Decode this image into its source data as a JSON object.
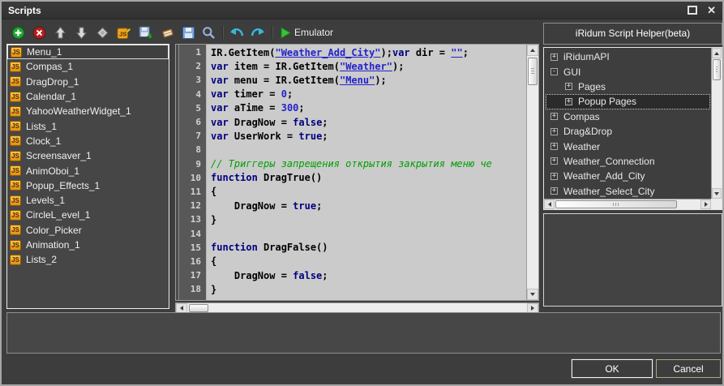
{
  "window": {
    "title": "Scripts",
    "close_glyph": "✕"
  },
  "left_toolbar": {
    "icons": [
      "add",
      "delete",
      "move-up",
      "move-down",
      "diamond",
      "edit-js",
      "save-script",
      "clear"
    ]
  },
  "editor_toolbar": {
    "icons": [
      "save",
      "find",
      "undo",
      "redo",
      "play"
    ],
    "emulator_label": "Emulator"
  },
  "script_list": {
    "badge": "JS",
    "items": [
      {
        "label": "Menu_1",
        "selected": true
      },
      {
        "label": "Compas_1",
        "selected": false
      },
      {
        "label": "DragDrop_1",
        "selected": false
      },
      {
        "label": "Calendar_1",
        "selected": false
      },
      {
        "label": "YahooWeatherWidget_1",
        "selected": false
      },
      {
        "label": "Lists_1",
        "selected": false
      },
      {
        "label": "Clock_1",
        "selected": false
      },
      {
        "label": "Screensaver_1",
        "selected": false
      },
      {
        "label": "AnimOboi_1",
        "selected": false
      },
      {
        "label": "Popup_Effects_1",
        "selected": false
      },
      {
        "label": "Levels_1",
        "selected": false
      },
      {
        "label": "CircleL_evel_1",
        "selected": false
      },
      {
        "label": "Color_Picker",
        "selected": false
      },
      {
        "label": "Animation_1",
        "selected": false
      },
      {
        "label": "Lists_2",
        "selected": false
      }
    ]
  },
  "editor": {
    "lines": [
      {
        "num": 1,
        "tokens": [
          [
            "IR.GetItem(",
            "p"
          ],
          [
            "\"Weather_Add_City\"",
            "s"
          ],
          [
            ");",
            "p"
          ],
          [
            "var",
            "k"
          ],
          [
            " dir = ",
            "p"
          ],
          [
            "\"\"",
            "s"
          ],
          [
            ";",
            "p"
          ]
        ]
      },
      {
        "num": 2,
        "tokens": [
          [
            "var",
            "k"
          ],
          [
            " item = IR.GetItem(",
            "p"
          ],
          [
            "\"Weather\"",
            "s"
          ],
          [
            ");",
            "p"
          ]
        ]
      },
      {
        "num": 3,
        "tokens": [
          [
            "var",
            "k"
          ],
          [
            " menu = IR.GetItem(",
            "p"
          ],
          [
            "\"Menu\"",
            "s"
          ],
          [
            ");",
            "p"
          ]
        ]
      },
      {
        "num": 4,
        "tokens": [
          [
            "var",
            "k"
          ],
          [
            " timer = ",
            "p"
          ],
          [
            "0",
            "n"
          ],
          [
            ";",
            "p"
          ]
        ]
      },
      {
        "num": 5,
        "tokens": [
          [
            "var",
            "k"
          ],
          [
            " aTime = ",
            "p"
          ],
          [
            "300",
            "n"
          ],
          [
            ";",
            "p"
          ]
        ]
      },
      {
        "num": 6,
        "tokens": [
          [
            "var",
            "k"
          ],
          [
            " DragNow = ",
            "p"
          ],
          [
            "false",
            "k"
          ],
          [
            ";",
            "p"
          ]
        ]
      },
      {
        "num": 7,
        "tokens": [
          [
            "var",
            "k"
          ],
          [
            " UserWork = ",
            "p"
          ],
          [
            "true",
            "k"
          ],
          [
            ";",
            "p"
          ]
        ]
      },
      {
        "num": 8,
        "tokens": []
      },
      {
        "num": 9,
        "tokens": [
          [
            "// Триггеры запрещения открытия закрытия меню че",
            "c"
          ]
        ]
      },
      {
        "num": 10,
        "tokens": [
          [
            "function",
            "k"
          ],
          [
            " DragTrue()",
            "p"
          ]
        ]
      },
      {
        "num": 11,
        "tokens": [
          [
            "{",
            "p"
          ]
        ]
      },
      {
        "num": 12,
        "tokens": [
          [
            "    DragNow = ",
            "p"
          ],
          [
            "true",
            "k"
          ],
          [
            ";",
            "p"
          ]
        ]
      },
      {
        "num": 13,
        "tokens": [
          [
            "}",
            "p"
          ]
        ]
      },
      {
        "num": 14,
        "tokens": []
      },
      {
        "num": 15,
        "tokens": [
          [
            "function",
            "k"
          ],
          [
            " DragFalse()",
            "p"
          ]
        ]
      },
      {
        "num": 16,
        "tokens": [
          [
            "{",
            "p"
          ]
        ]
      },
      {
        "num": 17,
        "tokens": [
          [
            "    DragNow = ",
            "p"
          ],
          [
            "false",
            "k"
          ],
          [
            ";",
            "p"
          ]
        ]
      },
      {
        "num": 18,
        "tokens": [
          [
            "}",
            "p"
          ]
        ]
      }
    ]
  },
  "helper": {
    "title": "iRidum Script Helper(beta)",
    "tree": [
      {
        "label": "iRidumAPI",
        "level": 0,
        "expander": "+",
        "selected": false
      },
      {
        "label": "GUI",
        "level": 0,
        "expander": "-",
        "selected": false
      },
      {
        "label": "Pages",
        "level": 1,
        "expander": "+",
        "selected": false
      },
      {
        "label": "Popup Pages",
        "level": 1,
        "expander": "+",
        "selected": true
      },
      {
        "label": "Compas",
        "level": 0,
        "expander": "+",
        "selected": false
      },
      {
        "label": "Drag&Drop",
        "level": 0,
        "expander": "+",
        "selected": false
      },
      {
        "label": "Weather",
        "level": 0,
        "expander": "+",
        "selected": false
      },
      {
        "label": "Weather_Connection",
        "level": 0,
        "expander": "+",
        "selected": false
      },
      {
        "label": "Weather_Add_City",
        "level": 0,
        "expander": "+",
        "selected": false
      },
      {
        "label": "Weather_Select_City",
        "level": 0,
        "expander": "+",
        "selected": false
      }
    ]
  },
  "buttons": {
    "ok": "OK",
    "cancel": "Cancel"
  },
  "colors": {
    "keyword": "#00007f",
    "string": "#2323cc",
    "number": "#2323cc",
    "comment": "#00a000",
    "js_badge_bg": "#f0a020",
    "editor_bg": "#cbcbcb",
    "panel_bg": "#3d3d3d"
  }
}
